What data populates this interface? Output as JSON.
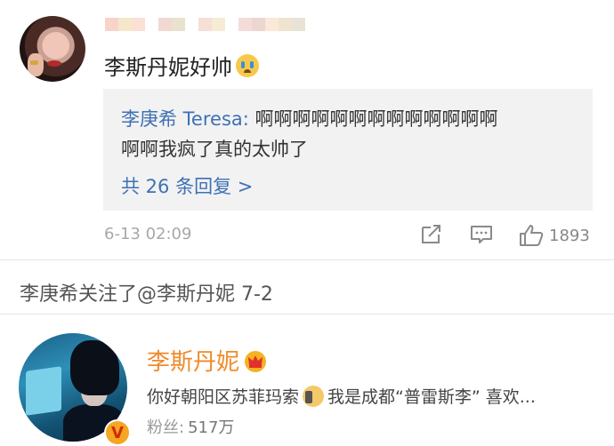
{
  "comment": {
    "text": "李斯丹妮好帅",
    "emoji": "crying-face-emoji",
    "reply": {
      "author": "李庚希 Teresa:",
      "body_line1": " 啊啊啊啊啊啊啊啊啊啊啊啊啊",
      "body_line2": "啊啊我疯了真的太帅了",
      "more_label": "共 26 条回复 >"
    },
    "time": "6-13 02:09",
    "likes": "1893",
    "username_pixel_colors": [
      "#f6d4c9",
      "#f5e7c9",
      "#fbe0d6",
      "#ffffff",
      "#f1d9d2",
      "#e8e2cf",
      "#ffffff",
      "#f5dfd7",
      "#f7ebd5",
      "#ffffff",
      "#f4dcd8",
      "#ecd6d0",
      "#fae9d9",
      "#f0e4d0",
      "#e9e2d6"
    ]
  },
  "follow_note": "李庚希关注了@李斯丹妮 7-2",
  "profile": {
    "name": "李斯丹妮",
    "bio_part1": "你好朝阳区苏菲玛索",
    "bio_part2": "我是成都“普雷斯李” 喜欢...",
    "fans_label": "粉丝:",
    "fans_count": "517万",
    "verified_badge": "V"
  },
  "colors": {
    "link_blue": "#3e71b5",
    "name_orange": "#f08a2a",
    "badge_gold": "#f5a623",
    "reply_bg": "#f2f2f2"
  }
}
